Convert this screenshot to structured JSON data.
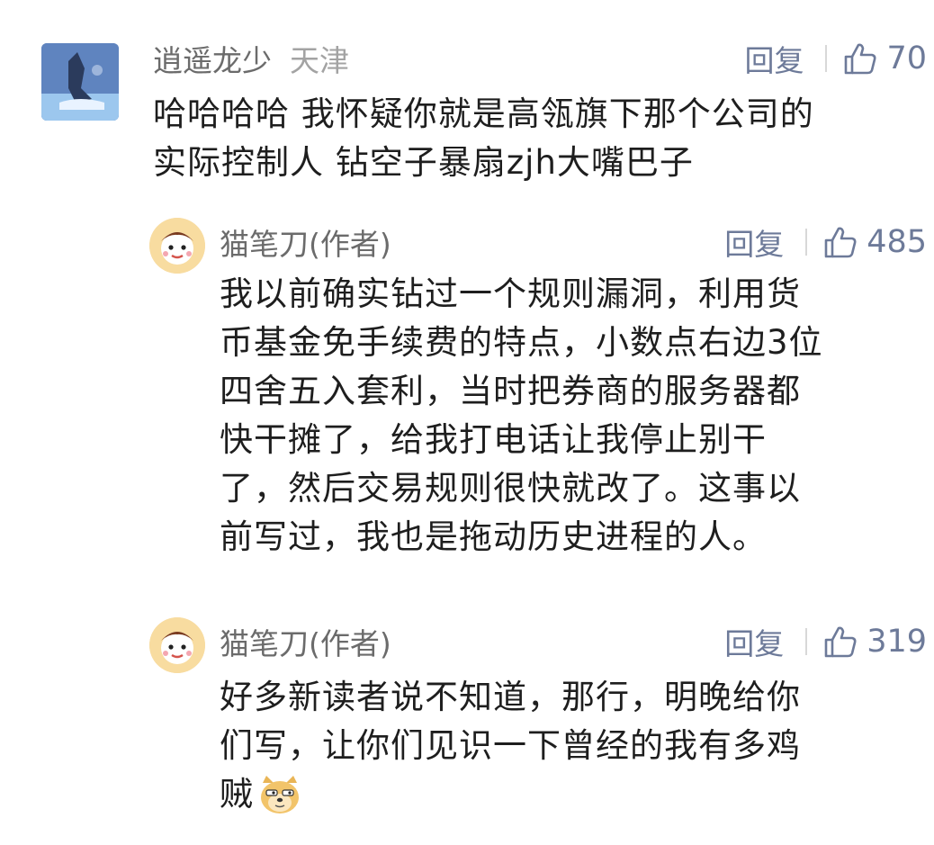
{
  "comments": [
    {
      "username": "逍遥龙少",
      "location": "天津",
      "reply_label": "回复",
      "likes": "70",
      "lines": [
        "哈哈哈哈 我怀疑你就是高瓴旗下那个公司的",
        "实际控制人 钻空子暴扇zjh大嘴巴子"
      ]
    },
    {
      "username": "猫笔刀(作者)",
      "reply_label": "回复",
      "likes": "485",
      "lines": [
        "我以前确实钻过一个规则漏洞，利用货",
        "币基金免手续费的特点，小数点右边3位",
        "四舍五入套利，当时把券商的服务器都",
        "快干摊了，给我打电话让我停止别干",
        "了，然后交易规则很快就改了。这事以",
        "前写过，我也是拖动历史进程的人。"
      ]
    },
    {
      "username": "猫笔刀(作者)",
      "reply_label": "回复",
      "likes": "319",
      "lines": [
        "好多新读者说不知道，那行，明晚给你",
        "们写，让你们见识一下曾经的我有多鸡",
        "贼"
      ]
    }
  ],
  "icons": {
    "like": "thumbs-up-icon",
    "emoji": "doge-emoji-icon"
  },
  "colors": {
    "username": "#6b6b6b",
    "location": "#a3a3a3",
    "action": "#6d7a99",
    "text": "#1e1e1e"
  }
}
